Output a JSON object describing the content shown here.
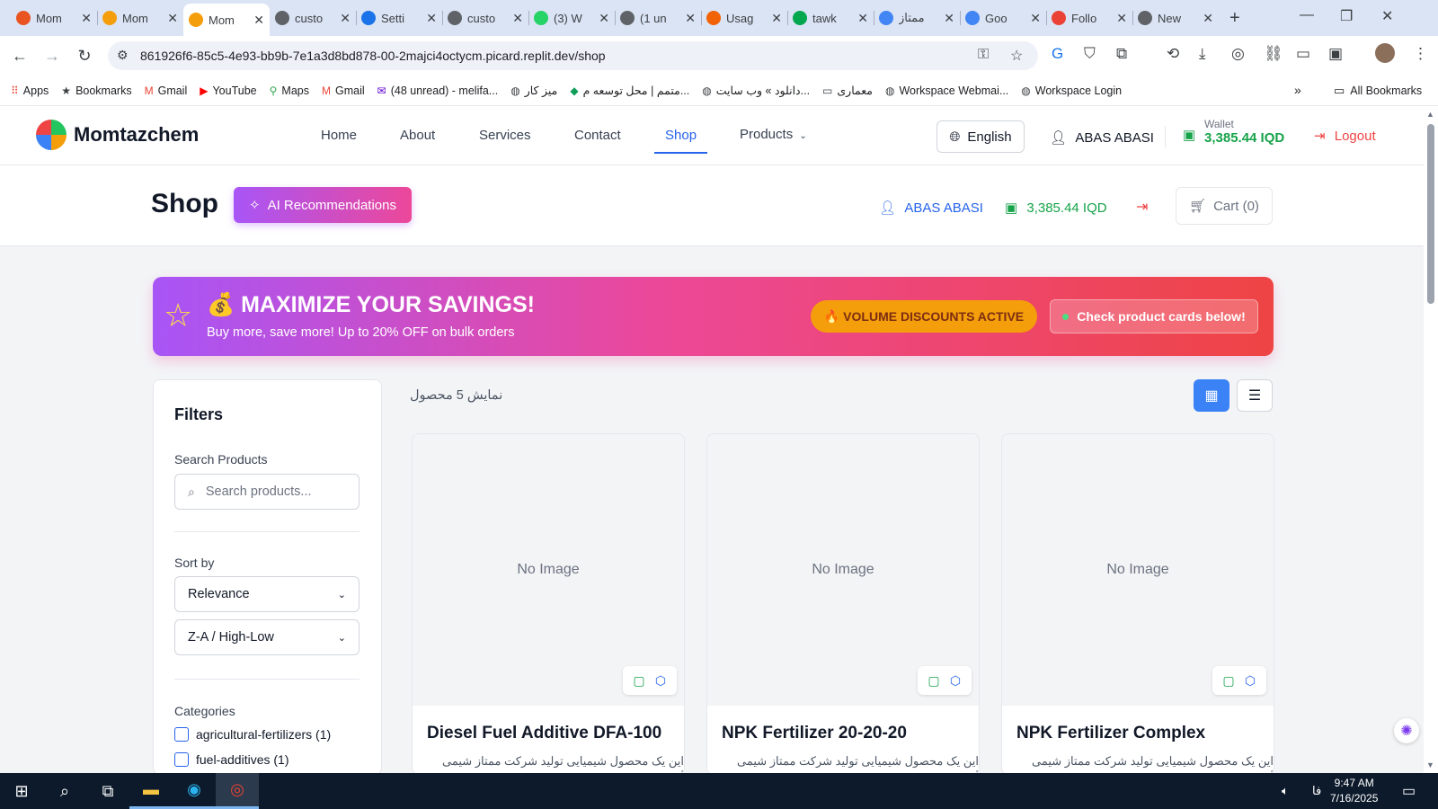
{
  "browser": {
    "tabs": [
      {
        "title": "Mom",
        "favicon": "ubuntu-orange-icon",
        "color": "#e95420"
      },
      {
        "title": "Mom",
        "favicon": "momtaz-logo-icon",
        "color": "#f59e0b"
      },
      {
        "title": "Mom",
        "favicon": "momtaz-logo-icon",
        "color": "#f59e0b",
        "active": true
      },
      {
        "title": "custo",
        "favicon": "globe-icon",
        "color": "#5f6368"
      },
      {
        "title": "Setti",
        "favicon": "gear-icon",
        "color": "#1a73e8"
      },
      {
        "title": "custo",
        "favicon": "globe-icon",
        "color": "#5f6368"
      },
      {
        "title": "(3) W",
        "favicon": "whatsapp-icon",
        "color": "#25d366"
      },
      {
        "title": "(1 un",
        "favicon": "cloud-icon",
        "color": "#5f6368"
      },
      {
        "title": "Usag",
        "favicon": "replit-icon",
        "color": "#f26207"
      },
      {
        "title": "tawk",
        "favicon": "tawk-icon",
        "color": "#03a84e"
      },
      {
        "title": "ممتاز",
        "favicon": "docs-icon",
        "color": "#4285f4"
      },
      {
        "title": "Goo",
        "favicon": "google-key-icon",
        "color": "#4285f4"
      },
      {
        "title": "Follo",
        "favicon": "gmail-icon",
        "color": "#ea4335"
      },
      {
        "title": "New",
        "favicon": "chrome-icon",
        "color": "#5f6368"
      }
    ],
    "new_tab": "+",
    "url": "861926f6-85c5-4e93-bb9b-7e1a3d8bd878-00-2majci4octycm.picard.replit.dev/shop",
    "bookmarks": [
      {
        "label": "Apps",
        "icon": "apps-grid-icon"
      },
      {
        "label": "Bookmarks",
        "icon": "star-icon"
      },
      {
        "label": "Gmail",
        "icon": "gmail-icon"
      },
      {
        "label": "YouTube",
        "icon": "youtube-icon"
      },
      {
        "label": "Maps",
        "icon": "maps-pin-icon"
      },
      {
        "label": "Gmail",
        "icon": "gmail-icon"
      },
      {
        "label": "(48 unread) - melifa...",
        "icon": "yahoo-mail-icon"
      },
      {
        "label": "میز کار",
        "icon": "globe-icon"
      },
      {
        "label": "متمم | محل توسعه م...",
        "icon": "motamem-icon"
      },
      {
        "label": "دانلود » وب سایت...",
        "icon": "globe-icon"
      },
      {
        "label": "معماری",
        "icon": "folder-icon"
      },
      {
        "label": "Workspace Webmai...",
        "icon": "globe-icon"
      },
      {
        "label": "Workspace Login",
        "icon": "globe-icon"
      }
    ],
    "all_bookmarks": "All Bookmarks"
  },
  "header": {
    "brand": "Momtazchem",
    "nav": [
      {
        "label": "Home"
      },
      {
        "label": "About"
      },
      {
        "label": "Services"
      },
      {
        "label": "Contact"
      },
      {
        "label": "Shop",
        "active": true
      },
      {
        "label": "Products"
      }
    ],
    "language": "English",
    "user": "ABAS ABASI",
    "wallet_label": "Wallet",
    "wallet_value": "3,385.44 IQD",
    "logout": "Logout"
  },
  "subheader": {
    "title": "Shop",
    "ai_button": "AI Recommendations",
    "user": "ABAS ABASI",
    "wallet": "3,385.44 IQD",
    "cart": "Cart (0)"
  },
  "promo": {
    "title": "💰 MAXIMIZE YOUR SAVINGS!",
    "subtitle": "Buy more, save more! Up to 20% OFF on bulk orders",
    "badge": "🔥 VOLUME DISCOUNTS ACTIVE",
    "check": "Check product cards below!"
  },
  "filters": {
    "title": "Filters",
    "search_label": "Search Products",
    "search_placeholder": "Search products...",
    "sort_label": "Sort by",
    "sort_value": "Relevance",
    "order_value": "Z-A / High-Low",
    "categories_label": "Categories",
    "categories": [
      {
        "label": "agricultural-fertilizers (1)",
        "checked": false
      },
      {
        "label": "fuel-additives (1)",
        "checked": false
      }
    ]
  },
  "results": {
    "count_text": "نمایش 5 محصول",
    "view_mode": "grid"
  },
  "products": [
    {
      "name": "Diesel Fuel Additive DFA-100",
      "image": "No Image",
      "desc": "این یک محصول شیمیایی تولید شرکت ممتاز شیمی است"
    },
    {
      "name": "NPK Fertilizer 20-20-20",
      "image": "No Image",
      "desc": "این یک محصول شیمیایی تولید شرکت ممتاز شیمی است"
    },
    {
      "name": "NPK Fertilizer Complex",
      "image": "No Image",
      "desc": "این یک محصول شیمیایی تولید شرکت ممتاز شیمی است"
    }
  ],
  "taskbar": {
    "lang": "فا",
    "time": "9:47 AM",
    "date": "7/16/2025"
  }
}
